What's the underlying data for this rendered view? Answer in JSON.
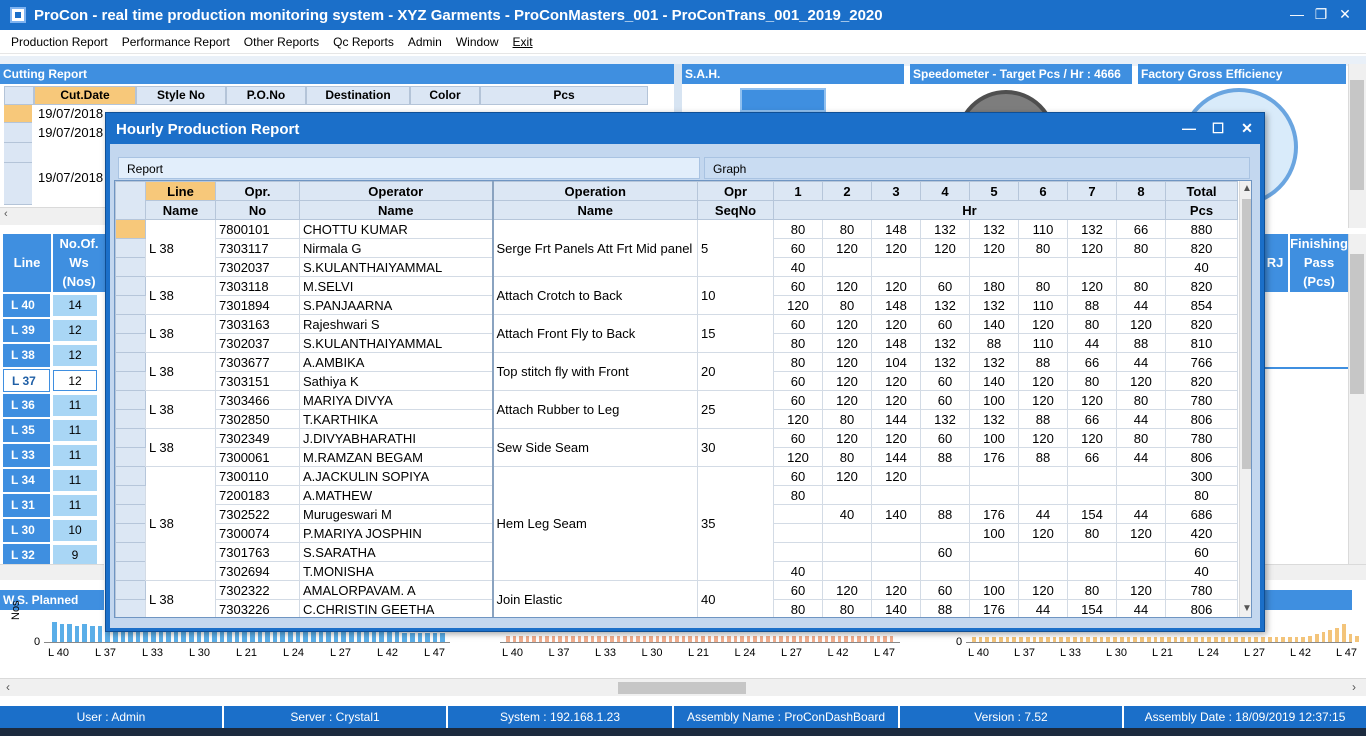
{
  "window": {
    "title": "ProCon - real time production monitoring system - XYZ Garments - ProConMasters_001 - ProConTrans_001_2019_2020",
    "minimize": "—",
    "restore": "❐",
    "close": "✕"
  },
  "menu": [
    "Production Report",
    "Performance Report",
    "Other Reports",
    "Qc Reports",
    "Admin",
    "Window",
    "Exit"
  ],
  "panels": {
    "cutting": "Cutting Report",
    "sah": "S.A.H.",
    "speedometer": "Speedometer - Target Pcs / Hr : 4666",
    "factory": "Factory Gross Efficiency",
    "ws_planned": "W.S. Planned"
  },
  "cutting_grid": {
    "headers": [
      "Cut.Date",
      "Style No",
      "P.O.No",
      "Destination",
      "Color",
      "Pcs"
    ],
    "dates": [
      "19/07/2018",
      "19/07/2018",
      "19/07/2018"
    ]
  },
  "line_panel": {
    "line_header": "Line",
    "ws_header": [
      "No.Of.",
      "Ws",
      "(Nos)"
    ],
    "finishing_header": [
      "Finishing",
      "Pass",
      "(Pcs)",
      "RJ"
    ],
    "rows": [
      {
        "line": "L 40",
        "ws": "14"
      },
      {
        "line": "L 39",
        "ws": "12"
      },
      {
        "line": "L 38",
        "ws": "12"
      },
      {
        "line": "L 37",
        "ws": "12"
      },
      {
        "line": "L 36",
        "ws": "11"
      },
      {
        "line": "L 35",
        "ws": "11"
      },
      {
        "line": "L 33",
        "ws": "11"
      },
      {
        "line": "L 34",
        "ws": "11"
      },
      {
        "line": "L 31",
        "ws": "11"
      },
      {
        "line": "L 30",
        "ws": "10"
      },
      {
        "line": "L 32",
        "ws": "9"
      }
    ]
  },
  "bottom_charts": {
    "ylabel": "Nos",
    "zero": "0",
    "labels": [
      "L 40",
      "L 37",
      "L 33",
      "L 30",
      "L 21",
      "L 24",
      "L 27",
      "L 42",
      "L 47"
    ]
  },
  "dialog": {
    "title": "Hourly Production Report",
    "tabs": [
      "Report",
      "Graph"
    ],
    "header_row1": [
      "Line",
      "Opr.",
      "Operator",
      "Operation",
      "Opr",
      "1",
      "2",
      "3",
      "4",
      "5",
      "6",
      "7",
      "8",
      "Total"
    ],
    "header_row2": [
      "Name",
      "No",
      "Name",
      "Name",
      "SeqNo",
      "Hr",
      "Pcs"
    ],
    "groups": [
      {
        "line": "L 38",
        "operation": "Serge Frt Panels Att Frt Mid panel",
        "seq": "5",
        "rows": [
          {
            "opr": "7800101",
            "name": "CHOTTU KUMAR",
            "hr": [
              "80",
              "80",
              "148",
              "132",
              "132",
              "110",
              "132",
              "66"
            ],
            "total": "880"
          },
          {
            "opr": "7303117",
            "name": "Nirmala G",
            "hr": [
              "60",
              "120",
              "120",
              "120",
              "120",
              "80",
              "120",
              "80"
            ],
            "total": "820"
          },
          {
            "opr": "7302037",
            "name": "S.KULANTHAIYAMMAL",
            "hr": [
              "40",
              "",
              "",
              "",
              "",
              "",
              "",
              ""
            ],
            "total": "40"
          }
        ]
      },
      {
        "line": "L 38",
        "operation": "Attach Crotch to Back",
        "seq": "10",
        "rows": [
          {
            "opr": "7303118",
            "name": "M.SELVI",
            "hr": [
              "60",
              "120",
              "120",
              "60",
              "180",
              "80",
              "120",
              "80"
            ],
            "total": "820"
          },
          {
            "opr": "7301894",
            "name": "S.PANJAARNA",
            "hr": [
              "120",
              "80",
              "148",
              "132",
              "132",
              "110",
              "88",
              "44"
            ],
            "total": "854"
          }
        ]
      },
      {
        "line": "L 38",
        "operation": "Attach Front Fly to Back",
        "seq": "15",
        "rows": [
          {
            "opr": "7303163",
            "name": "Rajeshwari S",
            "hr": [
              "60",
              "120",
              "120",
              "60",
              "140",
              "120",
              "80",
              "120"
            ],
            "total": "820"
          },
          {
            "opr": "7302037",
            "name": "S.KULANTHAIYAMMAL",
            "hr": [
              "80",
              "120",
              "148",
              "132",
              "88",
              "110",
              "44",
              "88"
            ],
            "total": "810"
          }
        ]
      },
      {
        "line": "L 38",
        "operation": "Top stitch fly with Front",
        "seq": "20",
        "rows": [
          {
            "opr": "7303677",
            "name": "A.AMBIKA",
            "hr": [
              "80",
              "120",
              "104",
              "132",
              "132",
              "88",
              "66",
              "44"
            ],
            "total": "766"
          },
          {
            "opr": "7303151",
            "name": "Sathiya K",
            "hr": [
              "60",
              "120",
              "120",
              "60",
              "140",
              "120",
              "80",
              "120"
            ],
            "total": "820"
          }
        ]
      },
      {
        "line": "L 38",
        "operation": "Attach Rubber to Leg",
        "seq": "25",
        "rows": [
          {
            "opr": "7303466",
            "name": "MARIYA DIVYA",
            "hr": [
              "60",
              "120",
              "120",
              "60",
              "100",
              "120",
              "120",
              "80"
            ],
            "total": "780"
          },
          {
            "opr": "7302850",
            "name": "T.KARTHIKA",
            "hr": [
              "120",
              "80",
              "144",
              "132",
              "132",
              "88",
              "66",
              "44"
            ],
            "total": "806"
          }
        ]
      },
      {
        "line": "L 38",
        "operation": "Sew Side Seam",
        "seq": "30",
        "rows": [
          {
            "opr": "7302349",
            "name": "J.DIVYABHARATHI",
            "hr": [
              "60",
              "120",
              "120",
              "60",
              "100",
              "120",
              "120",
              "80"
            ],
            "total": "780"
          },
          {
            "opr": "7300061",
            "name": "M.RAMZAN BEGAM",
            "hr": [
              "120",
              "80",
              "144",
              "88",
              "176",
              "88",
              "66",
              "44"
            ],
            "total": "806"
          }
        ]
      },
      {
        "line": "L 38",
        "operation": "Hem Leg Seam",
        "seq": "35",
        "rows": [
          {
            "opr": "7300110",
            "name": "A.JACKULIN SOPIYA",
            "hr": [
              "60",
              "120",
              "120",
              "",
              "",
              "",
              "",
              ""
            ],
            "total": "300"
          },
          {
            "opr": "7200183",
            "name": "A.MATHEW",
            "hr": [
              "80",
              "",
              "",
              "",
              "",
              "",
              "",
              ""
            ],
            "total": "80"
          },
          {
            "opr": "7302522",
            "name": "Murugeswari M",
            "hr": [
              "",
              "40",
              "140",
              "88",
              "176",
              "44",
              "154",
              "44"
            ],
            "total": "686"
          },
          {
            "opr": "7300074",
            "name": "P.MARIYA JOSPHIN",
            "hr": [
              "",
              "",
              "",
              "",
              "100",
              "120",
              "80",
              "120"
            ],
            "total": "420"
          },
          {
            "opr": "7301763",
            "name": "S.SARATHA",
            "hr": [
              "",
              "",
              "",
              "60",
              "",
              "",
              "",
              ""
            ],
            "total": "60"
          },
          {
            "opr": "7302694",
            "name": "T.MONISHA",
            "hr": [
              "40",
              "",
              "",
              "",
              "",
              "",
              "",
              ""
            ],
            "total": "40"
          }
        ]
      },
      {
        "line": "L 38",
        "operation": "Join Elastic",
        "seq": "40",
        "rows": [
          {
            "opr": "7302322",
            "name": "AMALORPAVAM. A",
            "hr": [
              "60",
              "120",
              "120",
              "60",
              "100",
              "120",
              "80",
              "120"
            ],
            "total": "780"
          },
          {
            "opr": "7303226",
            "name": "C.CHRISTIN GEETHA",
            "hr": [
              "80",
              "80",
              "140",
              "88",
              "176",
              "44",
              "154",
              "44"
            ],
            "total": "806"
          }
        ]
      }
    ]
  },
  "status": {
    "user": "User : Admin",
    "server": "Server : Crystal1",
    "system": "System : 192.168.1.23",
    "assembly": "Assembly Name : ProConDashBoard",
    "version": "Version : 7.52",
    "assembly_date": "Assembly Date : 18/09/2019 12:37:15"
  },
  "colors": {
    "title_blue": "#1b6fc9",
    "panel_blue": "#3f8fe0",
    "selected_orange": "#f7c87a",
    "ws_cell": "#a9d6f5"
  }
}
